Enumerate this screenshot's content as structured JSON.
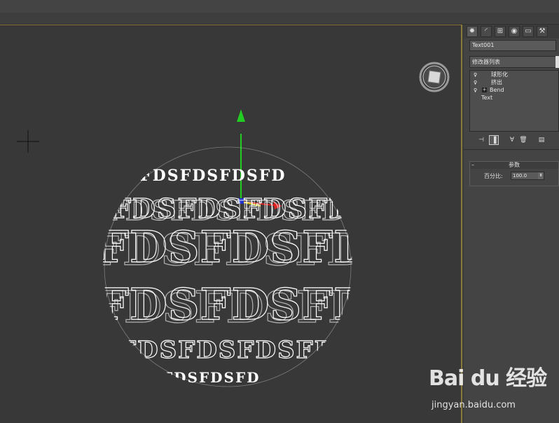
{
  "panel": {
    "tabs": [
      {
        "icon": "sun-icon"
      },
      {
        "icon": "modify-icon"
      },
      {
        "icon": "hierarchy-icon"
      },
      {
        "icon": "motion-icon"
      },
      {
        "icon": "display-icon"
      },
      {
        "icon": "utilities-icon"
      }
    ],
    "object_name": "Text001",
    "modifier_list_label": "修改器列表",
    "stack": [
      {
        "label": "球形化",
        "expandable": false
      },
      {
        "label": "挤出",
        "expandable": false
      },
      {
        "label": "Bend",
        "expandable": true
      },
      {
        "label": "Text",
        "expandable": false
      }
    ],
    "params": {
      "rollout_title": "参数",
      "percent_label": "百分比:",
      "percent_value": "100.0"
    }
  },
  "viewport": {
    "text_content": "FDSFDSFDSFD"
  },
  "watermark": {
    "logo": "Bai du 经验",
    "url": "jingyan.baidu.com"
  },
  "colors": {
    "viewport_bg": "#383838",
    "panel_bg": "#444444",
    "active_border": "#8a7a3a",
    "wire": "#ffffff"
  }
}
